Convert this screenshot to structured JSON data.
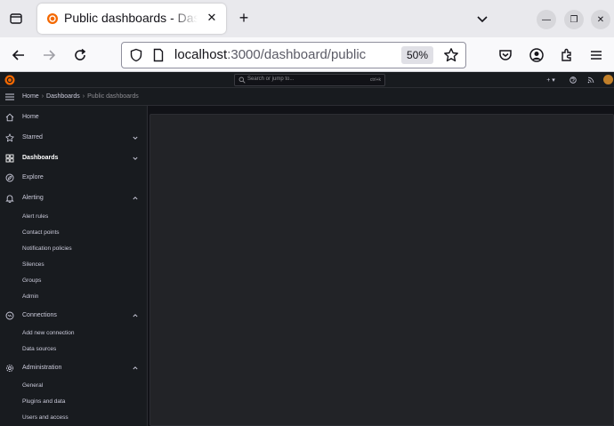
{
  "browser": {
    "tab_title": "Public dashboards - Dashboards - Grafana",
    "url_host": "localhost",
    "url_rest": ":3000/dashboard/public",
    "zoom": "50%"
  },
  "topbar": {
    "search_placeholder": "Search or jump to...",
    "search_shortcut": "ctrl+k",
    "plus_label": "+ ▾"
  },
  "breadcrumb": {
    "items": [
      "Home",
      "Dashboards",
      "Public dashboards"
    ]
  },
  "sidebar": {
    "items": [
      {
        "label": "Home"
      },
      {
        "label": "Starred"
      },
      {
        "label": "Dashboards"
      },
      {
        "label": "Explore"
      },
      {
        "label": "Alerting"
      },
      {
        "label": "Connections"
      },
      {
        "label": "Administration"
      }
    ],
    "alerting_children": [
      "Alert rules",
      "Contact points",
      "Notification policies",
      "Silences",
      "Groups",
      "Admin"
    ],
    "connections_children": [
      "Add new connection",
      "Data sources"
    ],
    "administration_children": [
      "General",
      "Plugins and data",
      "Users and access"
    ]
  },
  "colors": {
    "grafana_orange": "#f46800",
    "sidebar_bg": "#181b1f",
    "panel_bg": "#222327"
  }
}
